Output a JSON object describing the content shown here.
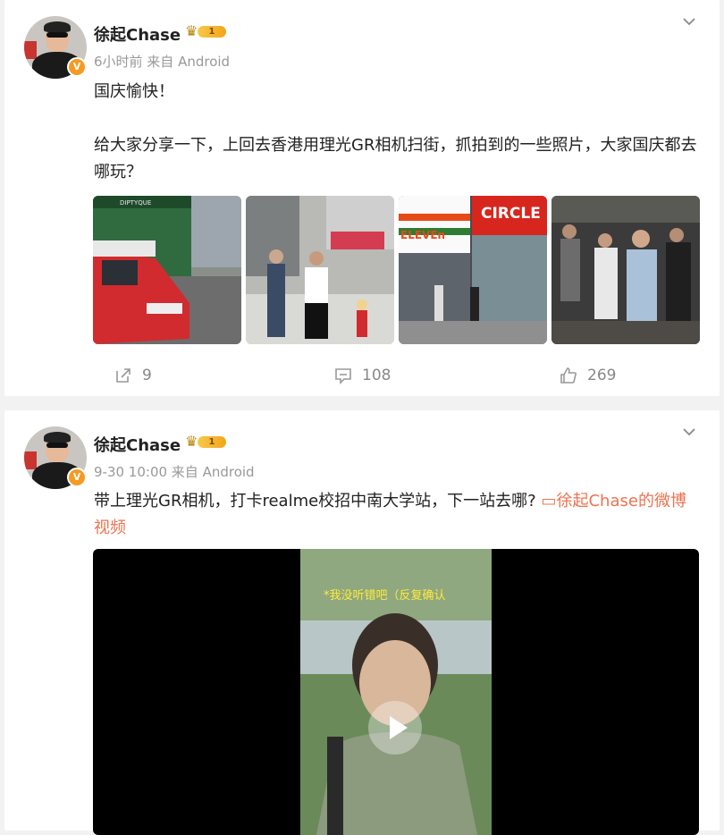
{
  "posts": [
    {
      "username": "徐起Chase",
      "rank_level": "1",
      "meta": "6小时前 来自 Android",
      "text": "国庆愉快！\n\n给大家分享一下，上回去香港用理光GR相机扫街，抓拍到的一些照片，大家国庆都去哪玩？",
      "images": [
        {
          "name": "street-taxi-photo",
          "overlay_text": "DIPTYQUE"
        },
        {
          "name": "street-pedestrians-photo",
          "overlay_text": ""
        },
        {
          "name": "seven-eleven-circle-k-photo",
          "overlay_text_1": "ELEVEn",
          "overlay_text_2": "CIRCLE"
        },
        {
          "name": "crowd-photo",
          "overlay_text": ""
        }
      ],
      "actions": {
        "repost": "9",
        "comment": "108",
        "like": "269"
      }
    },
    {
      "username": "徐起Chase",
      "rank_level": "1",
      "meta": "9-30 10:00 来自 Android",
      "text": "带上理光GR相机，打卡realme校招中南大学站，下一站去哪?",
      "video_link": "徐起Chase的微博视频",
      "video_caption": "*我没听错吧（反复确认"
    }
  ],
  "colors": {
    "link": "#eb7350",
    "badge": "#f59a23"
  },
  "icons": [
    "chevron-down-icon",
    "repost-icon",
    "comment-icon",
    "like-icon",
    "play-icon",
    "video-link-icon",
    "crown-icon",
    "verified-badge-icon"
  ]
}
